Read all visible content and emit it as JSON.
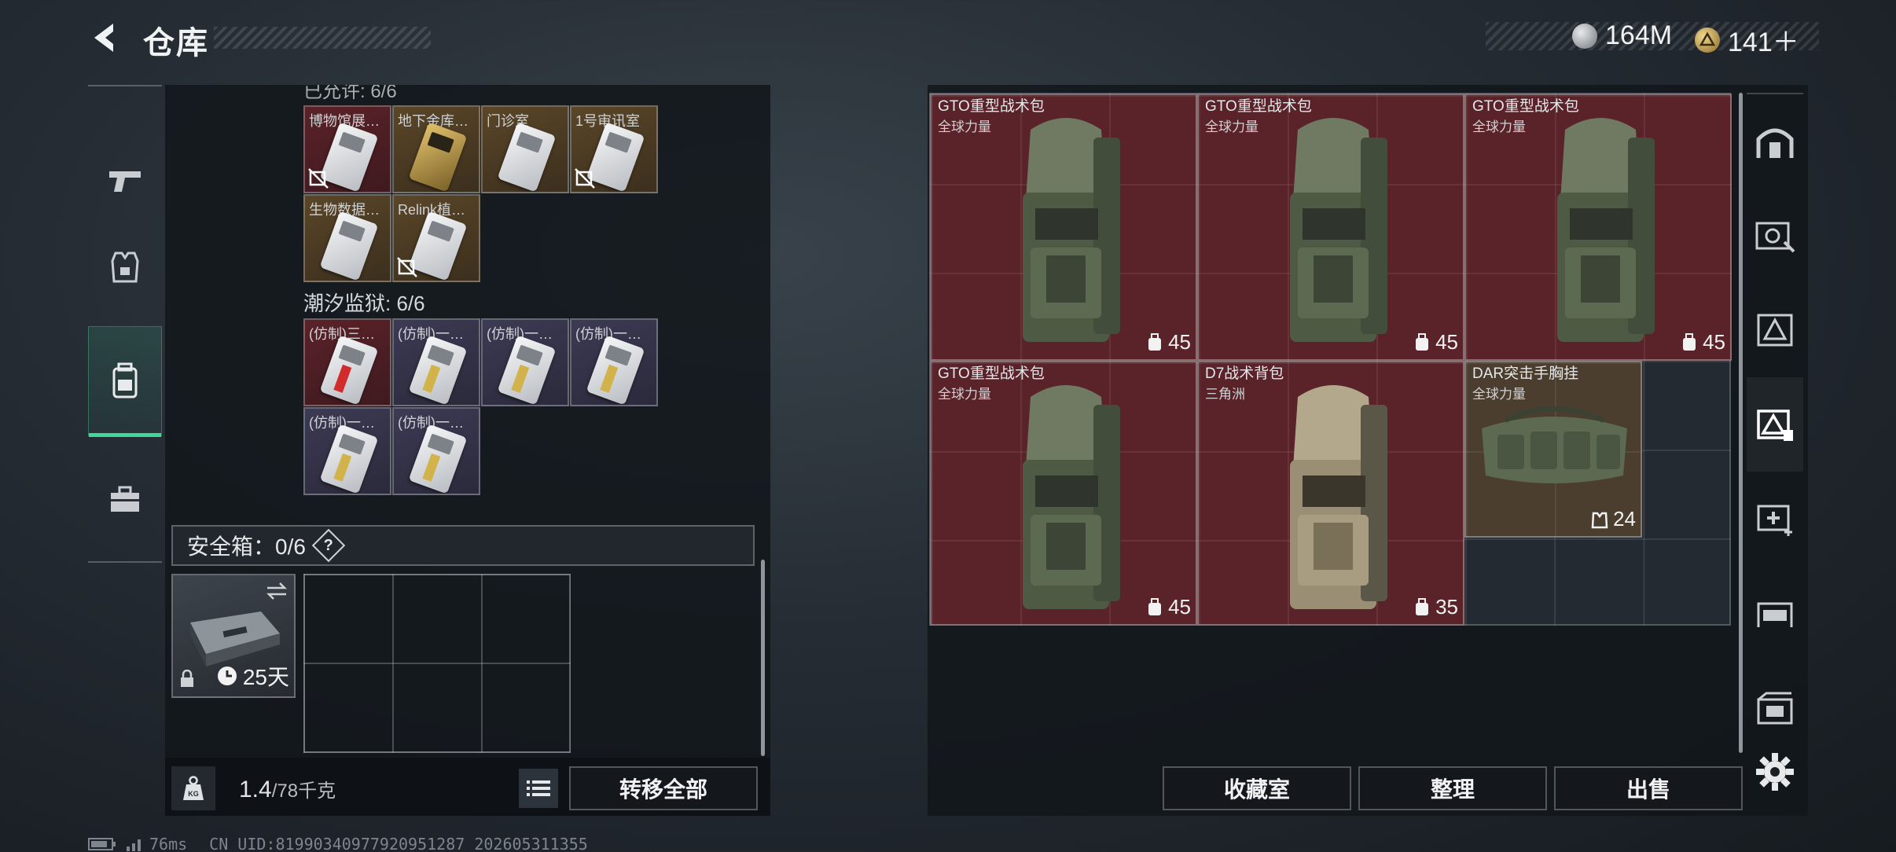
{
  "header": {
    "title": "仓库"
  },
  "currencies": [
    {
      "icon": "silver-coin-icon",
      "value": "164M"
    },
    {
      "icon": "gold-triangle-coin-icon",
      "value": "141＋"
    }
  ],
  "left_nav": [
    {
      "icon": "pistol-icon",
      "active": false
    },
    {
      "icon": "vest-icon",
      "active": false
    },
    {
      "icon": "backpack-icon",
      "active": true
    },
    {
      "icon": "toolbox-icon",
      "active": false
    }
  ],
  "keycards": {
    "section_top_partial": "已允许: 6/6",
    "group1": [
      {
        "name": "博物馆展…",
        "unbound": true
      },
      {
        "name": "地下金库…",
        "unbound": false
      },
      {
        "name": "门诊室",
        "unbound": false
      },
      {
        "name": "1号审讯室",
        "unbound": true
      },
      {
        "name": "生物数据…",
        "unbound": false
      },
      {
        "name": "Relink植…",
        "unbound": true
      }
    ],
    "group2_label": "潮汐监狱: 6/6",
    "group2": [
      {
        "name": "(仿制)三…"
      },
      {
        "name": "(仿制)一…"
      },
      {
        "name": "(仿制)一…"
      },
      {
        "name": "(仿制)一…"
      },
      {
        "name": "(仿制)一…"
      },
      {
        "name": "(仿制)一…"
      }
    ]
  },
  "safebox": {
    "label": "安全箱：0/6",
    "help": "?",
    "timer": "25天"
  },
  "weight": {
    "value": "1.4",
    "max": "/78千克"
  },
  "buttons": {
    "transfer_all": "转移全部",
    "collection": "收藏室",
    "organize": "整理",
    "sell": "出售"
  },
  "stash_items": [
    {
      "name": "GTO重型战术包",
      "sub": "全球力量",
      "cap": "45",
      "variant": "red"
    },
    {
      "name": "GTO重型战术包",
      "sub": "全球力量",
      "cap": "45",
      "variant": "red"
    },
    {
      "name": "GTO重型战术包",
      "sub": "全球力量",
      "cap": "45",
      "variant": "red"
    },
    {
      "name": "GTO重型战术包",
      "sub": "全球力量",
      "cap": "45",
      "variant": "red"
    },
    {
      "name": "D7战术背包",
      "sub": "三角洲",
      "cap": "35",
      "variant": "red"
    },
    {
      "name": "DAR突击手胸挂",
      "sub": "全球力量",
      "cap": "24",
      "variant": "gold"
    }
  ],
  "right_nav": [
    {
      "icon": "safe-house-icon"
    },
    {
      "icon": "weapon-workbench-icon"
    },
    {
      "icon": "armor-bench-icon"
    },
    {
      "icon": "tech-center-icon"
    },
    {
      "icon": "medical-station-icon"
    },
    {
      "icon": "firing-range-icon"
    },
    {
      "icon": "storage-crate-icon"
    }
  ],
  "status": {
    "ping": "76ms",
    "uid": "CN UID:81990340977920951287_202605311355"
  },
  "colors": {
    "accent": "#3fd79a",
    "item_red": "#5a2329",
    "item_gold": "#4c3e2e"
  }
}
